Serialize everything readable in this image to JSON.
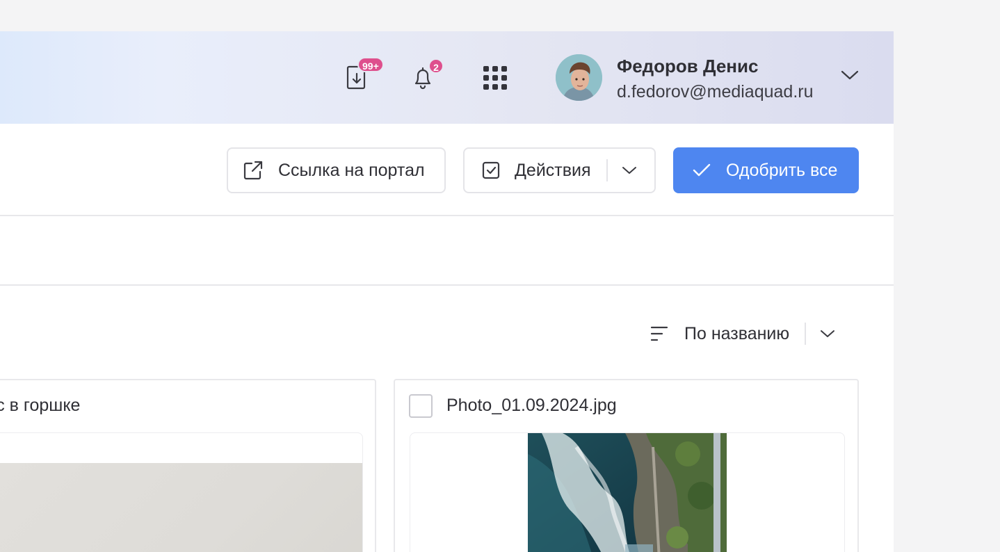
{
  "header": {
    "downloads_badge": "99+",
    "notifications_badge": "2",
    "user": {
      "name": "Федоров Денис",
      "email": "d.fedorov@mediaquad.ru"
    }
  },
  "toolbar": {
    "portal_link_label": "Ссылка на портал",
    "actions_label": "Действия",
    "approve_all_label": "Одобрить все"
  },
  "sort": {
    "selected": "По названию"
  },
  "cards": [
    {
      "title": "ус в горшке"
    },
    {
      "title": "Photo_01.09.2024.jpg"
    }
  ],
  "colors": {
    "accent": "#4e86f0",
    "badge": "#de4f8d"
  }
}
